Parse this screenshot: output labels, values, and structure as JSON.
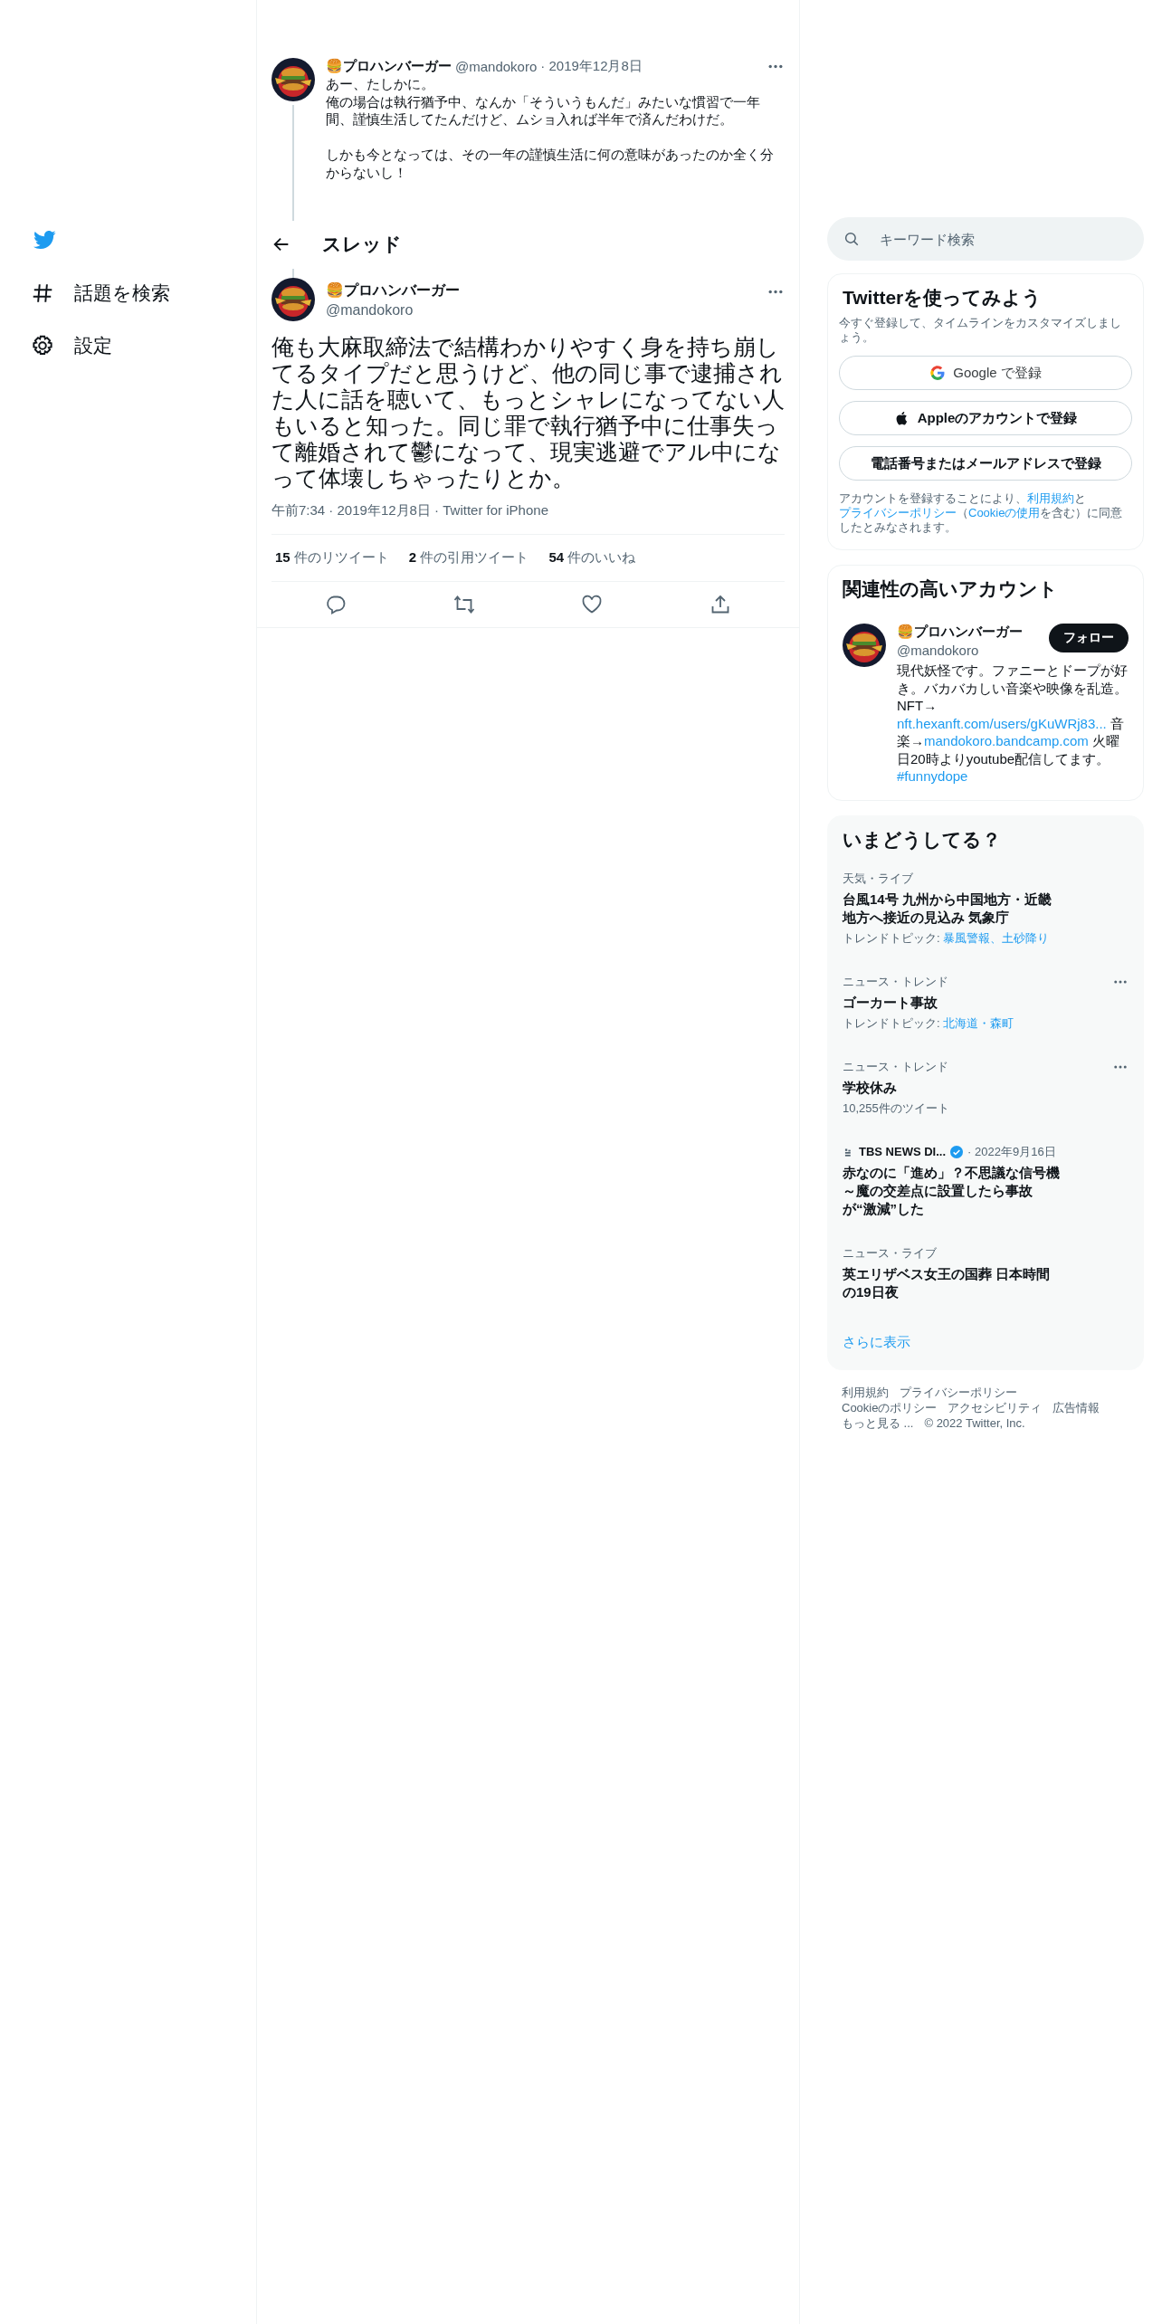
{
  "sidebar": {
    "items": [
      {
        "kind": "explore",
        "label": "話題を検索"
      },
      {
        "kind": "settings",
        "label": "設定"
      }
    ]
  },
  "previous_tweet": {
    "author": "🍔プロハンバーガー",
    "handle": "@mandokoro",
    "date": "· 2019年12月8日",
    "paragraphs": [
      [
        "あー、たしかに。",
        "俺の場合は執行猶予中、なんか「そういうもんだ」みたいな慣習で一年間、謹慎生活してたんだけど、ムショ入れば半年で済んだわけだ。"
      ],
      [
        "しかも今となっては、その一年の謹慎生活に何の意味があったのか全く分からないし！"
      ]
    ]
  },
  "thread_header": {
    "title": "スレッド"
  },
  "main_tweet": {
    "author": "🍔プロハンバーガー",
    "handle": "@mandokoro",
    "text": "俺も大麻取締法で結構わかりやすく身を持ち崩してるタイプだと思うけど、他の同じ事で逮捕された人に話を聴いて、もっとシャレになってない人もいると知った。同じ罪で執行猶予中に仕事失って離婚されて鬱になって、現実逃避でアル中になって体壊しちゃったりとか。",
    "meta": "午前7:34 · 2019年12月8日 · Twitter for iPhone",
    "stats": [
      {
        "count": "15",
        "label": "件のリツイート"
      },
      {
        "count": "2",
        "label": "件の引用ツイート"
      },
      {
        "count": "54",
        "label": "件のいいね"
      }
    ],
    "actions": [
      {
        "kind": "reply"
      },
      {
        "kind": "retweet"
      },
      {
        "kind": "like"
      },
      {
        "kind": "share"
      }
    ]
  },
  "search": {
    "placeholder": "キーワード検索"
  },
  "signup": {
    "title": "Twitterを使ってみよう",
    "subtitle": "今すぐ登録して、タイムラインをカスタマイズしましょう。",
    "buttons": [
      {
        "kind": "google",
        "label": "Google で登録"
      },
      {
        "kind": "apple",
        "label": "Appleのアカウントで登録"
      },
      {
        "kind": "phone",
        "label": "電話番号またはメールアドレスで登録"
      }
    ],
    "legal": [
      {
        "text": "アカウントを登録することにより、",
        "link": false
      },
      {
        "text": "利用規約",
        "link": true
      },
      {
        "text": "と",
        "link": false
      },
      {
        "text": "プライバシーポリシー",
        "link": true
      },
      {
        "text": "（",
        "link": false
      },
      {
        "text": "Cookieの使用",
        "link": true
      },
      {
        "text": "を含む）に同意したとみなされます。",
        "link": false
      }
    ]
  },
  "related": {
    "title": "関連性の高いアカウント",
    "account": {
      "name": "🍔プロハンバーガー",
      "handle": "@mandokoro",
      "follow_label": "フォロー",
      "bio": [
        {
          "text": "現代妖怪です。ファニーとドープが好き。バカバカしい音楽や映像を乱造。NFT→ ",
          "link": false
        },
        {
          "text": "nft.hexanft.com/users/gKuWRj83...",
          "link": true
        },
        {
          "text": " 音楽→",
          "link": false
        },
        {
          "text": "mandokoro.bandcamp.com",
          "link": true
        },
        {
          "text": " 火曜日20時よりyoutube配信してます。 ",
          "link": false
        },
        {
          "text": "#funnydope",
          "link": true
        }
      ]
    }
  },
  "trends": {
    "title": "いまどうしてる？",
    "items": [
      {
        "kind": "trend",
        "context": "天気・ライブ",
        "title": "台風14号 九州から中国地方・近畿地方へ接近の見込み 気象庁",
        "topics_label": "トレンドトピック:",
        "topics": "暴風警報、土砂降り",
        "more": false
      },
      {
        "kind": "trend",
        "context": "ニュース・トレンド",
        "title": "ゴーカート事故",
        "topics_label": "トレンドトピック:",
        "topics": "北海道・森町",
        "more": true
      },
      {
        "kind": "trend",
        "context": "ニュース・トレンド",
        "title": "学校休み",
        "meta": "10,255件のツイート",
        "more": true
      },
      {
        "kind": "news",
        "source": "TBS NEWS DI...",
        "verified": true,
        "date": "· 2022年9月16日",
        "title": "赤なのに「進め」？不思議な信号機～魔の交差点に設置したら事故が“激減”した"
      },
      {
        "kind": "trend",
        "context": "ニュース・ライブ",
        "title": "英エリザベス女王の国葬 日本時間の19日夜",
        "more": false
      }
    ],
    "show_more": "さらに表示"
  },
  "footer": {
    "links": [
      "利用規約",
      "プライバシーポリシー",
      "Cookieのポリシー",
      "アクセシビリティ",
      "広告情報",
      "もっと見る ..."
    ],
    "copyright": "© 2022 Twitter, Inc."
  }
}
